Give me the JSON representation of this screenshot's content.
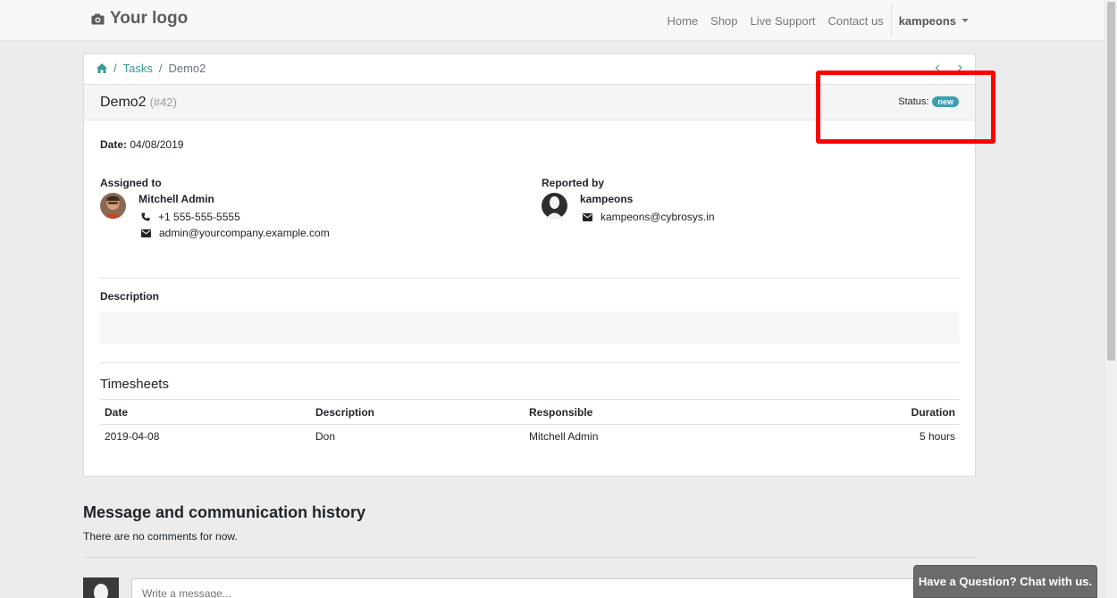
{
  "navbar": {
    "logo_text": "Your logo",
    "links": [
      "Home",
      "Shop",
      "Live Support",
      "Contact us"
    ],
    "user": "kampeons"
  },
  "breadcrumb": {
    "section": "Tasks",
    "current": "Demo2"
  },
  "task": {
    "title": "Demo2",
    "id_label": "(#42)",
    "status_label": "Status:",
    "status_value": "new",
    "date_label": "Date:",
    "date_value": "04/08/2019"
  },
  "assigned": {
    "title": "Assigned to",
    "name": "Mitchell Admin",
    "phone": "+1 555-555-5555",
    "email": "admin@yourcompany.example.com"
  },
  "reported": {
    "title": "Reported by",
    "name": "kampeons",
    "email": "kampeons@cybrosys.in"
  },
  "description": {
    "title": "Description"
  },
  "timesheets": {
    "title": "Timesheets",
    "headers": {
      "date": "Date",
      "description": "Description",
      "responsible": "Responsible",
      "duration": "Duration"
    },
    "rows": [
      {
        "date": "2019-04-08",
        "description": "Don",
        "responsible": "Mitchell Admin",
        "duration": "5 hours"
      }
    ]
  },
  "messages": {
    "title": "Message and communication history",
    "empty_text": "There are no comments for now.",
    "placeholder": "Write a message..."
  },
  "chat_button": "Have a Question? Chat with us.",
  "colors": {
    "accent": "#3a9a9a",
    "badge": "#3aa0b0",
    "highlight": "#ff0000"
  }
}
